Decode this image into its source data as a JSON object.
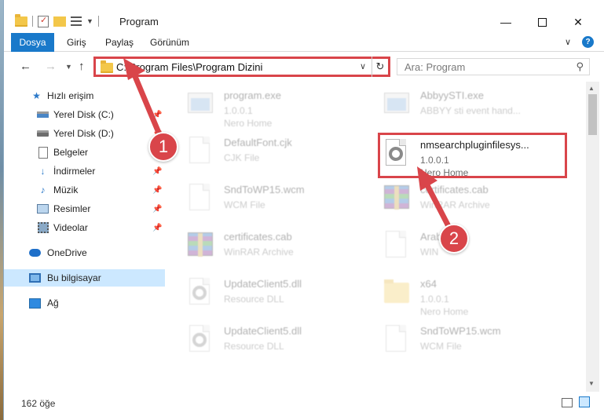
{
  "window": {
    "title": "Program"
  },
  "ribbon": {
    "tabs": [
      {
        "label": "Dosya",
        "active": true
      },
      {
        "label": "Giriş"
      },
      {
        "label": "Paylaş"
      },
      {
        "label": "Görünüm"
      }
    ],
    "help": "?"
  },
  "navigation": {
    "address": "C:\\Program Files\\Program Dizini",
    "search_placeholder": "Ara: Program"
  },
  "sidebar": {
    "items": [
      {
        "label": "Hızlı erişim",
        "icon": "star-icon"
      },
      {
        "label": "Yerel Disk (C:)",
        "icon": "drive-icon",
        "pinned": true
      },
      {
        "label": "Yerel Disk (D:)",
        "icon": "drive-icon",
        "pinned": true
      },
      {
        "label": "Belgeler",
        "icon": "documents-icon",
        "pinned": true
      },
      {
        "label": "İndirmeler",
        "icon": "downloads-icon",
        "pinned": true
      },
      {
        "label": "Müzik",
        "icon": "music-icon",
        "pinned": true
      },
      {
        "label": "Resimler",
        "icon": "pictures-icon",
        "pinned": true
      },
      {
        "label": "Videolar",
        "icon": "videos-icon",
        "pinned": true
      },
      {
        "label": "OneDrive",
        "icon": "cloud-icon"
      },
      {
        "label": "Bu bilgisayar",
        "icon": "computer-icon",
        "selected": true
      },
      {
        "label": "Ağ",
        "icon": "network-icon"
      }
    ]
  },
  "files": [
    {
      "name": "program.exe",
      "type": "1.0.0.1",
      "sub": "Nero Home",
      "icon": "exe-icon"
    },
    {
      "name": "AbbyySTI.exe",
      "type": "ABBYY sti event hand...",
      "icon": "exe-icon"
    },
    {
      "name": "DefaultFont.cjk",
      "type": "CJK File",
      "icon": "file-icon"
    },
    {
      "name": "nmsearchpluginfilesys...",
      "type": "1.0.0.1",
      "sub": "Nero Home",
      "icon": "gear-file-icon",
      "highlighted": true
    },
    {
      "name": "SndToWP15.wcm",
      "type": "WCM File",
      "icon": "file-icon"
    },
    {
      "name": "certificates.cab",
      "type": "WinRAR Archive",
      "icon": "rar-icon"
    },
    {
      "name": "certificates.cab",
      "type": "WinRAR Archive",
      "icon": "rar-icon"
    },
    {
      "name": "Arab",
      "type": "WIN",
      "icon": "file-icon"
    },
    {
      "name": "UpdateClient5.dll",
      "type": "Resource DLL",
      "icon": "gear-file-icon"
    },
    {
      "name": "x64",
      "type": "1.0.0.1",
      "sub": "Nero Home",
      "icon": "folder-icon"
    },
    {
      "name": "UpdateClient5.dll",
      "type": "Resource DLL",
      "icon": "gear-file-icon"
    },
    {
      "name": "SndToWP15.wcm",
      "type": "WCM File",
      "icon": "file-icon"
    }
  ],
  "callouts": [
    "1",
    "2"
  ],
  "status": {
    "count": "162 öğe"
  },
  "colors": {
    "accent": "#1979ca",
    "highlight": "#d9454a",
    "selected_bg": "#cce8ff"
  }
}
